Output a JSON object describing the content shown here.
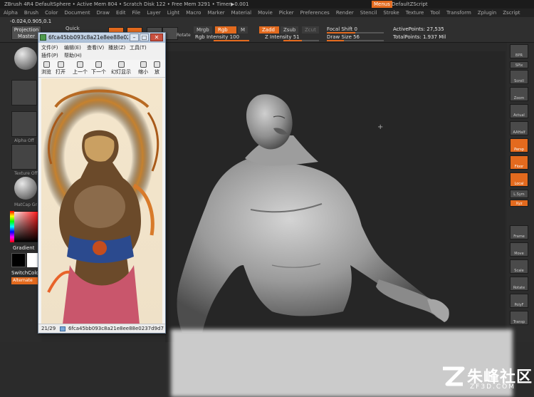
{
  "titlebar": {
    "text": "ZBrush 4R4   DefaultSphere  • Active Mem 804 • Scratch Disk 122 • Free Mem 3291 • Timer▶0.001",
    "menus_btn": "Menus",
    "right_label": "DefaultZScript"
  },
  "menubar": [
    "Alpha",
    "Brush",
    "Color",
    "Document",
    "Draw",
    "Edit",
    "File",
    "Layer",
    "Light",
    "Macro",
    "Marker",
    "Material",
    "Movie",
    "Picker",
    "Preferences",
    "Render",
    "Stencil",
    "Stroke",
    "Texture",
    "Tool",
    "Transform",
    "Zplugin",
    "Zscript"
  ],
  "toolstrip": {
    "coords": "-0.024,0.905,0.1",
    "projection_master": "Projection Master",
    "quick_sketch": "Quick",
    "rotate_label": "Rotate",
    "mrgb": "Mrgb",
    "rgb": "Rgb",
    "m": "M",
    "zadd": "Zadd",
    "zsub": "Zsub",
    "zcut": "Zcut",
    "rgb_intensity": "Rgb  Intensity 100",
    "z_intensity": "Z Intensity 51",
    "focal_shift": "Focal Shift 0",
    "draw_size": "Draw Size 56",
    "active_points": "ActivePoints: 27,535",
    "total_points": "TotalPoints: 1.937 Mil",
    "rgb_intensity_value": 1.0,
    "z_intensity_value": 0.51,
    "focal_shift_value": 0.5,
    "draw_size_value": 0.3
  },
  "left_shelf": {
    "material_lbl": "MatCap Gr",
    "alpha_lbl": "Alpha Off",
    "texture_lbl": "Texture Off",
    "gradient": "Gradient",
    "switch_color": "SwitchColor",
    "alternate": "Alternate"
  },
  "right_shelf": [
    "BPR",
    "SPix",
    "Scroll",
    "Zoom",
    "Actual",
    "AAHalf",
    "Persp",
    "Floor",
    "Local",
    "L.Sym",
    "Xyz",
    "Frame",
    "Move",
    "Scale",
    "Rotate",
    "PolyF",
    "Transp"
  ],
  "viewer": {
    "filename": "6fca45bb093c8a21e8ee88e0237d9d7",
    "menu": [
      "文件(F)",
      "编辑(E)",
      "查看(V)",
      "播放(Z)",
      "工具(T)",
      "插件(P)",
      "帮助(H)"
    ],
    "tools": [
      "浏览",
      "打开",
      "上一个",
      "下一个",
      "幻灯显示",
      "缩小",
      "放"
    ],
    "counter": "21/29",
    "status_file": "6fca45bb093c8a21e8ee88e0237d9d7"
  },
  "watermark": {
    "cn": "朱峰社区",
    "en": "ZF3D.COM"
  }
}
